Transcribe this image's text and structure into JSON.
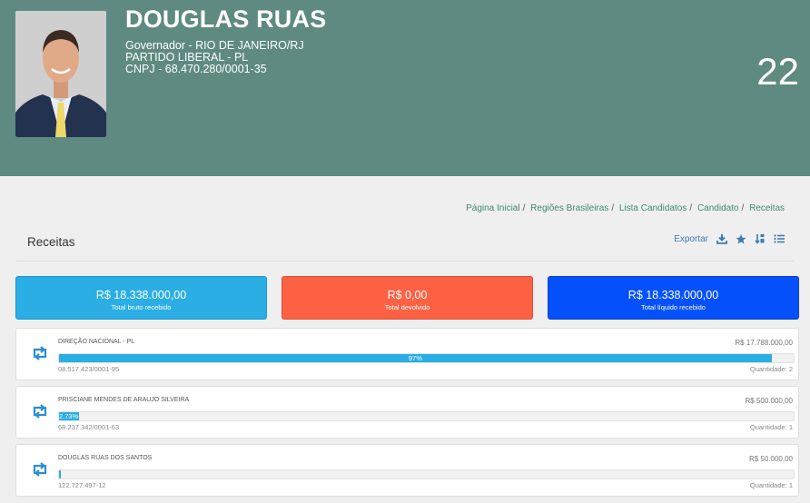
{
  "candidate": {
    "name": "DOUGLAS RUAS",
    "office": "Governador - RIO DE JANEIRO/RJ",
    "party": "PARTIDO LIBERAL - PL",
    "cnpj": "CNPJ - 68.470.280/0001-35",
    "number": "22"
  },
  "breadcrumb": [
    "Página Inicial",
    "Regiões Brasileiras",
    "Lista Candidatos",
    "Candidato",
    "Receitas"
  ],
  "section": {
    "title": "Receitas"
  },
  "toolbar": {
    "export_label": "Exportar",
    "icons": [
      "download-icon",
      "star-icon",
      "sort-icon",
      "list-icon"
    ]
  },
  "totals": [
    {
      "value": "R$ 18.338.000,00",
      "label": "Total bruto recebido",
      "color": "#2aaee4"
    },
    {
      "value": "R$ 0,00",
      "label": "Total devolvido",
      "color": "#fd6144"
    },
    {
      "value": "R$ 18.338.000,00",
      "label": "Total líquido recebido",
      "color": "#0451fb"
    }
  ],
  "donors": [
    {
      "name": "DIREÇÃO NACIONAL - PL",
      "amount": "R$ 17.788.000,00",
      "percent": 97,
      "percent_label": "97%",
      "document": "08.517.423/0001-95",
      "quantity": "Quantidade: 2"
    },
    {
      "name": "PRISCIANE MENDES DE ARAUJO SILVEIRA",
      "amount": "R$ 500.000,00",
      "percent": 2.73,
      "percent_label": "2.73%",
      "document": "68.237.342/0001-63",
      "quantity": "Quantidade: 1"
    },
    {
      "name": "DOUGLAS RUAS DOS SANTOS",
      "amount": "R$ 50.000,00",
      "percent": 0.27,
      "percent_label": "",
      "document": "122.727.497-12",
      "quantity": "Quantidade: 1"
    }
  ],
  "colors": {
    "header": "#5e8a82",
    "accent": "#2aaee4",
    "link": "#3d8a6b"
  }
}
